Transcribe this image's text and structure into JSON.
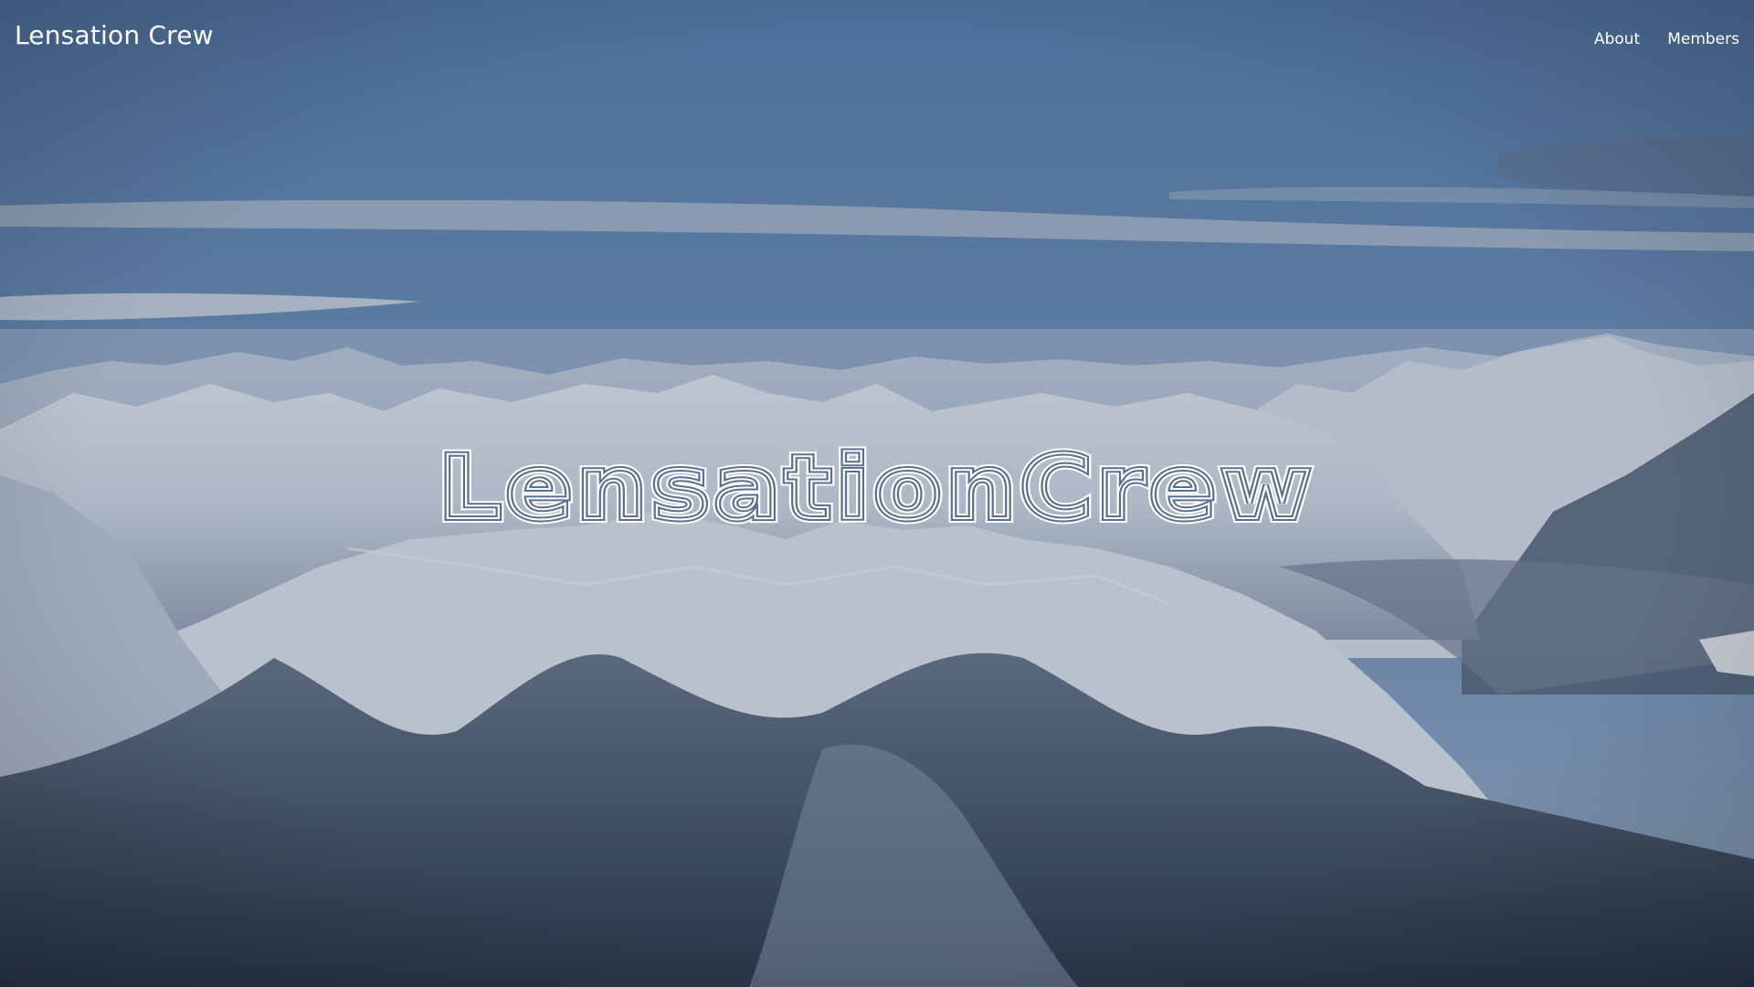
{
  "header": {
    "brand": "Lensation Crew",
    "nav": [
      {
        "label": "About"
      },
      {
        "label": "Members"
      }
    ]
  },
  "hero": {
    "headline": "LensationCrew",
    "background": "snowy-mountain-range-photo"
  },
  "colors": {
    "sky_top": "#5f86b4",
    "sky_bottom": "#8ea9c8",
    "snow": "#e8edf5",
    "forest": "#344153",
    "text": "#ffffff"
  }
}
